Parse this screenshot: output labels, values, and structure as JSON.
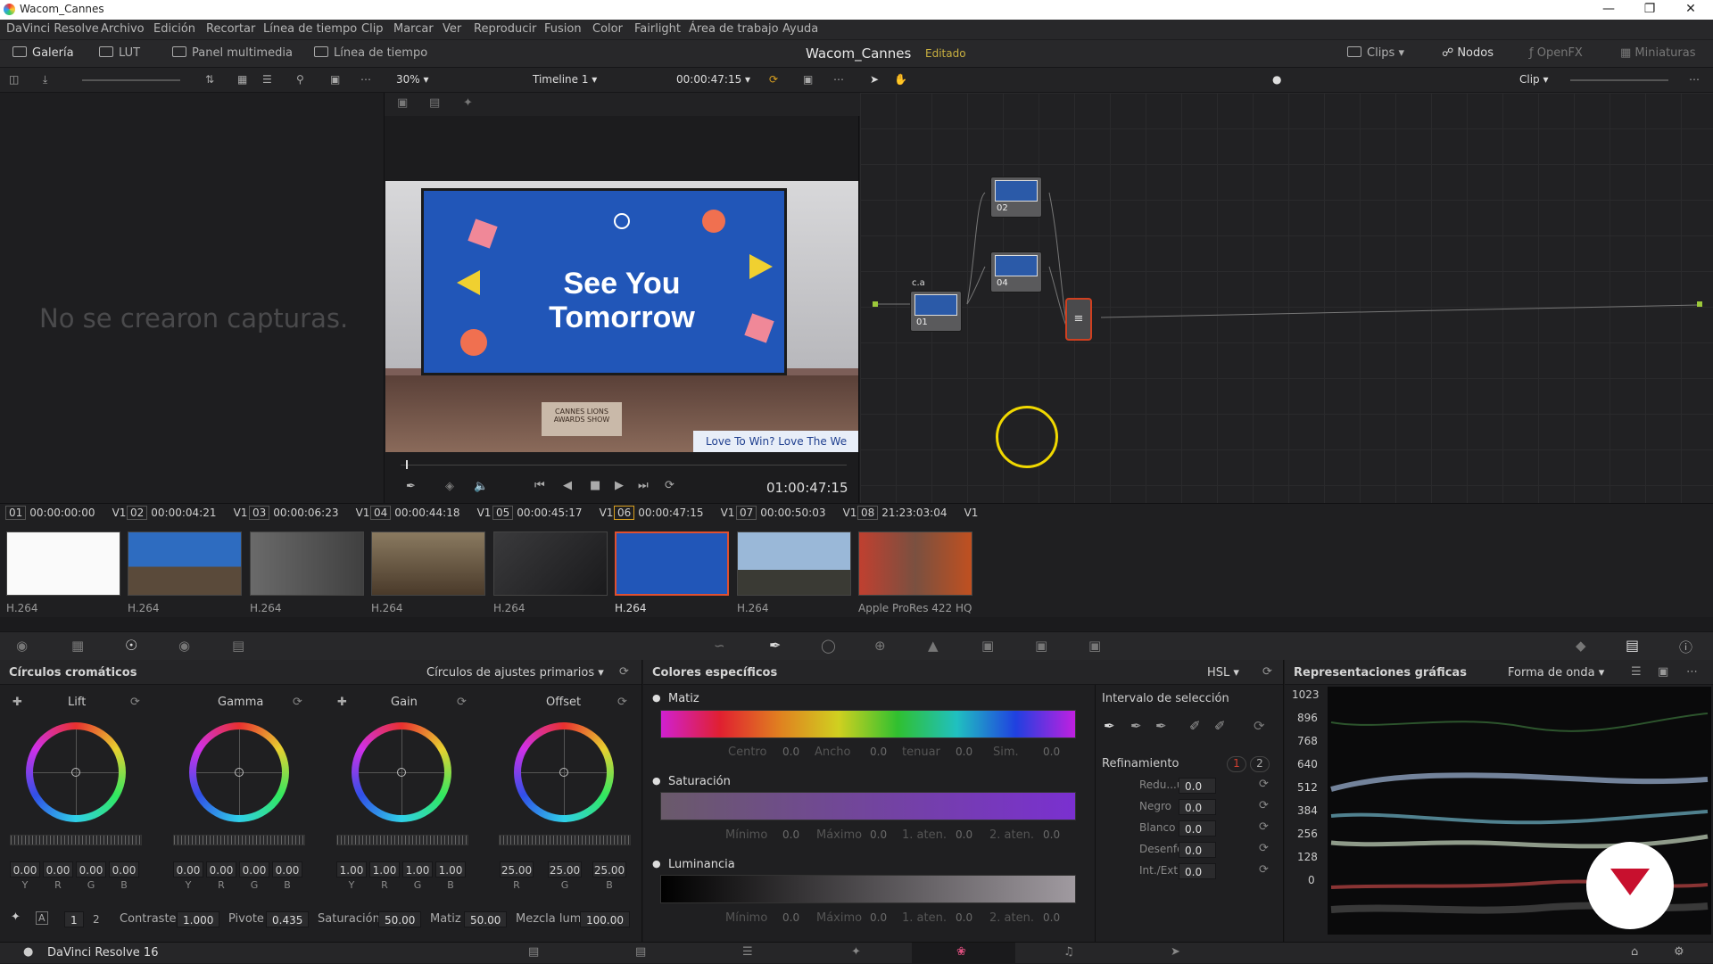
{
  "window": {
    "title": "Wacom_Cannes"
  },
  "menubar": {
    "items": [
      "DaVinci Resolve",
      "Archivo",
      "Edición",
      "Recortar",
      "Línea de tiempo",
      "Clip",
      "Marcar",
      "Ver",
      "Reproducir",
      "Fusion",
      "Color",
      "Fairlight",
      "Área de trabajo",
      "Ayuda"
    ]
  },
  "topbar": {
    "gallery": "Galería",
    "lut": "LUT",
    "media": "Panel multimedia",
    "timeline": "Línea de tiempo",
    "project": "Wacom_Cannes",
    "status": "Editado",
    "clips": "Clips",
    "nodes": "Nodos",
    "openfx": "OpenFX",
    "thumbs": "Miniaturas"
  },
  "subbar": {
    "zoom": "30%",
    "timeline_name": "Timeline 1",
    "timecode": "00:00:47:15",
    "mode": "Clip"
  },
  "gallery": {
    "empty_msg": "No se crearon capturas."
  },
  "viewer": {
    "line1": "See You",
    "line2": "Tomorrow",
    "banner": "Love To Win? Love The We",
    "sign1": "CANNES LIONS",
    "sign2": "AWARDS SHOW",
    "timecode": "01:00:47:15"
  },
  "nodes": {
    "n1": "01",
    "n1_tag": "c.a",
    "n2": "02",
    "n3": "04"
  },
  "clips": [
    {
      "num": "01",
      "tc": "00:00:00:00",
      "track": "V1",
      "codec": "H.264"
    },
    {
      "num": "02",
      "tc": "00:00:04:21",
      "track": "V1",
      "codec": "H.264"
    },
    {
      "num": "03",
      "tc": "00:00:06:23",
      "track": "V1",
      "codec": "H.264"
    },
    {
      "num": "04",
      "tc": "00:00:44:18",
      "track": "V1",
      "codec": "H.264"
    },
    {
      "num": "05",
      "tc": "00:00:45:17",
      "track": "V1",
      "codec": "H.264"
    },
    {
      "num": "06",
      "tc": "00:00:47:15",
      "track": "V1",
      "codec": "H.264"
    },
    {
      "num": "07",
      "tc": "00:00:50:03",
      "track": "V1",
      "codec": "H.264"
    },
    {
      "num": "08",
      "tc": "21:23:03:04",
      "track": "V1",
      "codec": "Apple ProRes 422 HQ"
    }
  ],
  "wheels": {
    "title": "Círculos cromáticos",
    "mode": "Círculos de ajustes primarios",
    "lift": {
      "label": "Lift",
      "vals": [
        "0.00",
        "0.00",
        "0.00",
        "0.00"
      ],
      "ch": [
        "Y",
        "R",
        "G",
        "B"
      ]
    },
    "gamma": {
      "label": "Gamma",
      "vals": [
        "0.00",
        "0.00",
        "0.00",
        "0.00"
      ],
      "ch": [
        "Y",
        "R",
        "G",
        "B"
      ]
    },
    "gain": {
      "label": "Gain",
      "vals": [
        "1.00",
        "1.00",
        "1.00",
        "1.00"
      ],
      "ch": [
        "Y",
        "R",
        "G",
        "B"
      ]
    },
    "offset": {
      "label": "Offset",
      "vals": [
        "25.00",
        "25.00",
        "25.00"
      ],
      "ch": [
        "R",
        "G",
        "B"
      ]
    },
    "bottom": {
      "p1": "1",
      "p2": "2",
      "contrast_l": "Contraste",
      "contrast": "1.000",
      "pivot_l": "Pivote",
      "pivot": "0.435",
      "sat_l": "Saturación",
      "sat": "50.00",
      "hue_l": "Matiz",
      "hue": "50.00",
      "mix_l": "Mezcla lum.",
      "mix": "100.00"
    }
  },
  "qualifier": {
    "title": "Colores específicos",
    "mode": "HSL",
    "hue": "Matiz",
    "sat": "Saturación",
    "lum": "Luminancia",
    "hue_fields": [
      "Centro",
      "Ancho",
      "tenuar",
      "Sim."
    ],
    "sat_fields": [
      "Mínimo",
      "Máximo",
      "1. aten.",
      "2. aten."
    ],
    "zero": "0.0",
    "range_title": "Intervalo de selección",
    "refine_title": "Refinamiento",
    "r1": "1",
    "r2": "2",
    "refine": [
      {
        "l": "Redu...uido",
        "v": "0.0"
      },
      {
        "l": "Negro",
        "v": "0.0"
      },
      {
        "l": "Blanco",
        "v": "0.0"
      },
      {
        "l": "Desenfoque",
        "v": "0.0"
      },
      {
        "l": "Int./Ext.",
        "v": "0.0"
      }
    ]
  },
  "scopes": {
    "title": "Representaciones gráficas",
    "mode": "Forma de onda",
    "ticks": [
      "1023",
      "896",
      "768",
      "640",
      "512",
      "384",
      "256",
      "128",
      "0"
    ]
  },
  "pagebar": {
    "app": "DaVinci Resolve 16"
  }
}
